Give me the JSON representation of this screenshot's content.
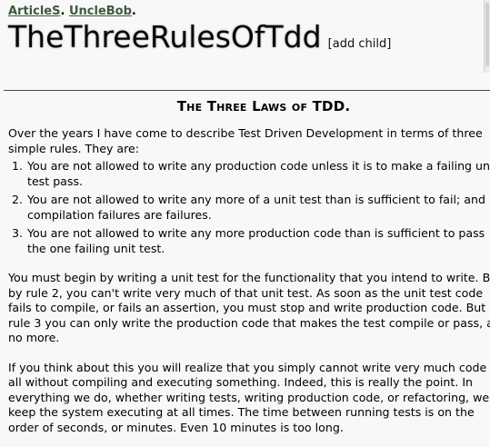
{
  "breadcrumb": {
    "items": [
      "ArticleS",
      "UncleBob"
    ],
    "separator": "."
  },
  "title": "TheThreeRulesOfTdd",
  "add_child_label": "[add child]",
  "article": {
    "heading": "The Three Laws of TDD.",
    "intro_lines": [
      "Over the years I have come to describe Test Driven Development in terms of three",
      "simple rules. They are:"
    ],
    "rules": [
      {
        "number": "1.",
        "lines": [
          "You are not allowed to write any production code unless it is to make a failing unit",
          "test pass."
        ]
      },
      {
        "number": "2.",
        "lines": [
          "You are not allowed to write any more of a unit test than is sufficient to fail; and",
          "compilation failures are failures."
        ]
      },
      {
        "number": "3.",
        "lines": [
          "You are not allowed to write any more production code than is sufficient to pass",
          "the one failing unit test."
        ]
      }
    ],
    "paragraph_1_lines": [
      "You must begin by writing a unit test for the functionality that you intend to write. But",
      "by rule 2, you can't write very much of that unit test. As soon as the unit test code",
      "fails to compile, or fails an assertion, you must stop and write production code. But by",
      "rule 3 you can only write the production code that makes the test compile or pass, and",
      "no more."
    ],
    "paragraph_2_lines": [
      "If you think about this you will realize that you simply cannot write very much code at",
      "all without compiling and executing something. Indeed, this is really the point. In",
      "everything we do, whether writing tests, writing production code, or refactoring, we",
      "keep the system executing at all times. The time between running tests is on the",
      "order of seconds, or minutes. Even 10 minutes is too long."
    ]
  }
}
